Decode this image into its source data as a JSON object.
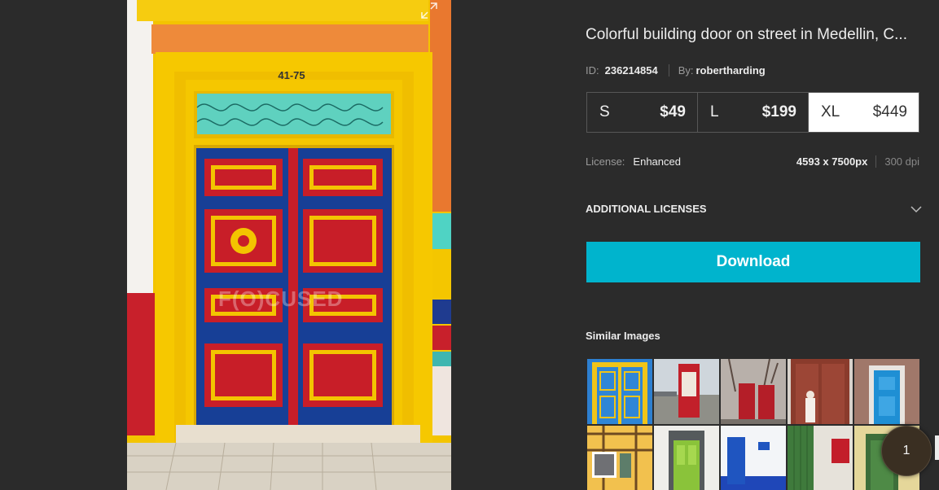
{
  "image": {
    "title": "Colorful building door on street in Medellin, C...",
    "id_label": "ID:",
    "id_value": "236214854",
    "by_label": "By:",
    "by_value": "robertharding",
    "address_plate": "41-75",
    "watermark": "F(O)CUSED"
  },
  "sizes": [
    {
      "size": "S",
      "price": "$49",
      "selected": false
    },
    {
      "size": "L",
      "price": "$199",
      "selected": false
    },
    {
      "size": "XL",
      "price": "$449",
      "selected": true
    }
  ],
  "license": {
    "label": "License:",
    "value": "Enhanced",
    "dimensions": "4593 x 7500px",
    "dpi": "300 dpi"
  },
  "additional_licenses": {
    "label": "ADDITIONAL LICENSES",
    "icon": "chevron-down-icon"
  },
  "download": {
    "label": "Download"
  },
  "similar": {
    "title": "Similar Images",
    "thumbs": [
      "blue-yellow-door",
      "red-phone-booth-river",
      "red-phone-booths-trees",
      "ornate-wooden-door-woman",
      "blue-door-brick",
      "yellow-timber-house",
      "green-door-grey-frame",
      "blue-door-white-wall",
      "green-door-red-box",
      "green-door-yellow-wall"
    ]
  },
  "counter": {
    "value": "1"
  },
  "colors": {
    "background": "#2b2b2b",
    "accent": "#00b4cd",
    "text": "#ececec",
    "muted": "#9a9a9a"
  }
}
